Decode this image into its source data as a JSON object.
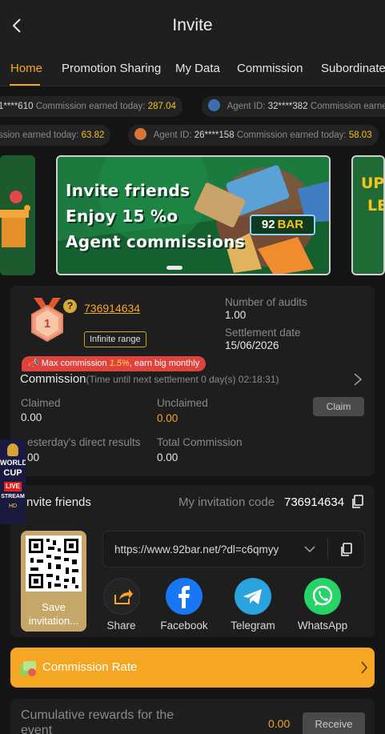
{
  "header": {
    "title": "Invite"
  },
  "tabs": [
    {
      "label": "Home"
    },
    {
      "label": "Promotion Sharing"
    },
    {
      "label": "My Data"
    },
    {
      "label": "Commission"
    },
    {
      "label": "Subordinate"
    }
  ],
  "ticker": {
    "row1": [
      {
        "agent_id": "1****610",
        "label": "Commission earned today:",
        "amount": "287.04",
        "id_label": ""
      },
      {
        "agent_id": "32****382",
        "label": "Commission earne",
        "amount": "",
        "id_label": "Agent ID:"
      }
    ],
    "row2": [
      {
        "agent_id": "",
        "label": "ssion earned today:",
        "amount": "63.82",
        "id_label": ""
      },
      {
        "agent_id": "26****158",
        "label": "Commission earned today:",
        "amount": "58.03",
        "id_label": "Agent ID:"
      }
    ]
  },
  "banner": {
    "line1": "Invite friends",
    "line2": "Enjoy  15 %o",
    "line3": "Agent  commissions",
    "logo_number": "92",
    "logo_word": "BAR",
    "right_text_top": "UP",
    "right_text_bottom": "LE"
  },
  "agent": {
    "level": "1",
    "id": "736914634",
    "range_badge": "Infinite range",
    "audits_label": "Number of audits",
    "audits_value": "1.00",
    "settlement_label": "Settlement date",
    "settlement_value": "15/06/2026",
    "max_badge_prefix": "Max commission ",
    "max_badge_rate": "1.5%",
    "max_badge_suffix": ", earn big monthly",
    "commission_title": "Commission",
    "commission_sub": "(Time until next settlement  0 day(s) 02:18:31)",
    "claimed_label": "Claimed",
    "claimed_value": "0.00",
    "unclaimed_label": "Unclaimed",
    "unclaimed_value": "0.00",
    "claim_button": "Claim",
    "yesterday_label": "esterday's direct results",
    "yesterday_value": "00",
    "total_label": "Total Commission",
    "total_value": "0.00"
  },
  "invite": {
    "title": "nvite friends",
    "code_label": "My invitation code",
    "code_value": "736914634",
    "url": "https://www.92bar.net/?dl=c6qmyy",
    "save_label_line1": "Save",
    "save_label_line2": "invitation...",
    "share_options": [
      {
        "label": "Share",
        "icon": "share-icon"
      },
      {
        "label": "Facebook",
        "icon": "facebook-icon"
      },
      {
        "label": "Telegram",
        "icon": "telegram-icon"
      },
      {
        "label": "WhatsApp",
        "icon": "whatsapp-icon"
      }
    ]
  },
  "floating_ad": {
    "line1": "WORLD",
    "line2": "CUP",
    "line3": "LIVE",
    "line4": "STREAM",
    "line5": "HD"
  },
  "commission_rate": {
    "label": "Commission Rate"
  },
  "cumulative": {
    "label_line1": "Cumulative rewards for the",
    "label_line2": "event",
    "value": "0.00",
    "button": "Receive"
  },
  "colors": {
    "accent": "#f5a623",
    "background": "#141414",
    "card": "#1e1e1e",
    "danger": "#e0423c"
  }
}
